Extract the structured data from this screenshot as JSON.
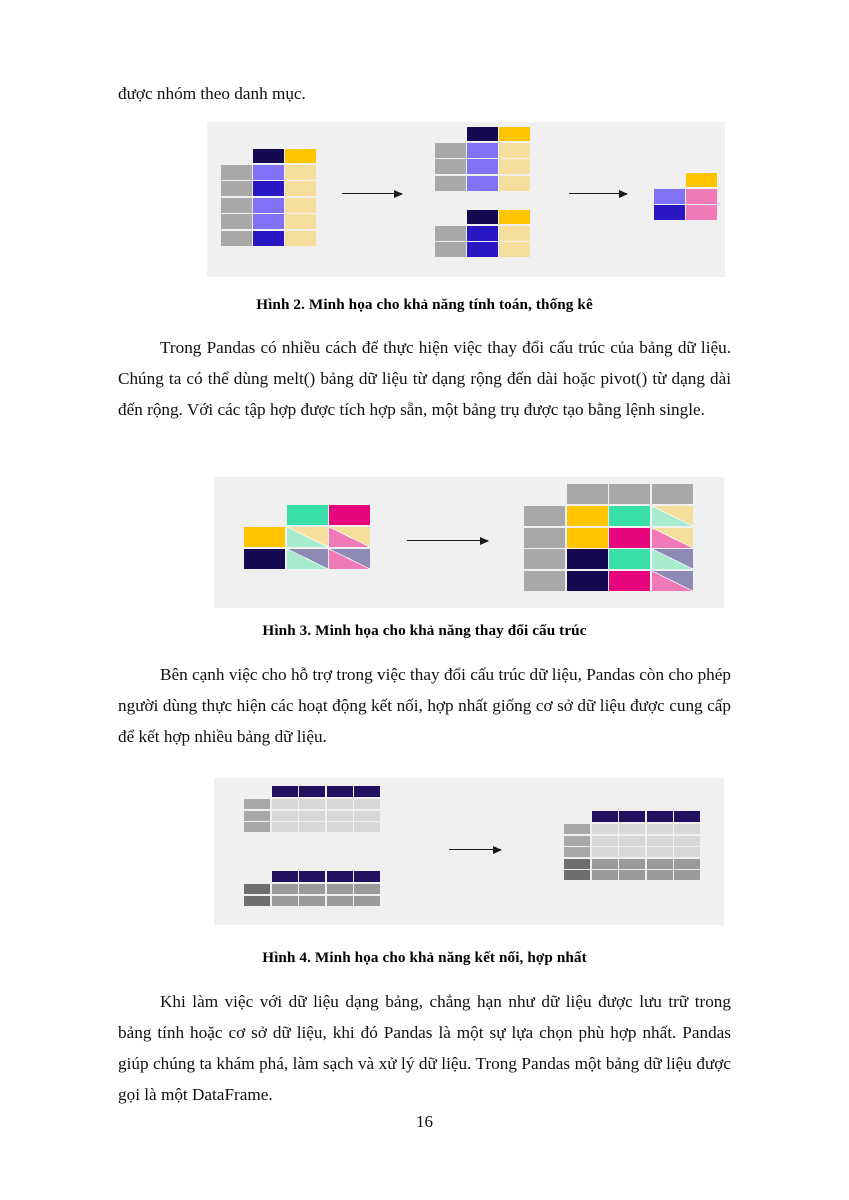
{
  "page": {
    "number": "16",
    "background": "#ffffff",
    "figure_panel_bg": "#f0f0f0"
  },
  "paragraphs": {
    "p0": "được nhóm theo danh mục.",
    "p1": "Trong Pandas có nhiều cách để thực hiện việc thay đổi cấu trúc của bảng dữ liệu. Chúng ta có thể dùng melt() bảng dữ liệu từ dạng rộng đến dài hoặc pivot() từ dạng dài đến rộng. Với các tập hợp được tích hợp sẵn, một bảng trụ được tạo bằng lệnh single.",
    "p2": "Bên cạnh việc cho hỗ trợ trong việc thay đổi cấu trúc dữ liệu, Pandas còn cho phép người dùng thực hiện các hoạt động kết nối, hợp nhất giống cơ sở dữ liệu được cung cấp để kết hợp nhiều bảng dữ liệu.",
    "p3": "Khi làm việc với dữ liệu dạng bảng, chẳng hạn như dữ liệu được lưu trữ trong bảng tính hoặc cơ sở dữ liệu, khi đó Pandas là một sự lựa chọn phù hợp nhất. Pandas giúp chúng ta khám phá, làm sạch và xử lý dữ liệu. Trong Pandas một bảng dữ liệu được gọi là một DataFrame."
  },
  "captions": {
    "fig2": "Hình 2. Minh họa cho khả năng tính toán, thống kê",
    "fig3": "Hình 3. Minh họa cho khả năng thay đổi cấu trúc",
    "fig4": "Hình 4. Minh họa cho khả năng kết nối, hợp nhất"
  },
  "palette": {
    "gray": "#a8a8a8",
    "gray_light": "#d7d7d7",
    "gray_mid": "#9a9a9a",
    "gray_dark": "#6e6e6e",
    "navy": "#150a4f",
    "navy_header": "#221060",
    "blue": "#2a17c4",
    "periwinkle": "#8172f5",
    "gold": "#ffc400",
    "cream": "#f5dd9b",
    "pink": "#f07ab8",
    "magenta": "#e8067f",
    "mint": "#38dfa6",
    "mint_light": "#a8ecd0",
    "slate": "#8d8bb5",
    "panel": "#f0f0f0"
  },
  "figure2": {
    "name": "groupby-aggregation-illustration",
    "arrows": 2,
    "source_table": {
      "header": [
        null,
        "navy",
        "gold"
      ],
      "rows": [
        [
          "gray",
          "periwinkle",
          "cream"
        ],
        [
          "gray",
          "blue",
          "cream"
        ],
        [
          "gray",
          "periwinkle",
          "cream"
        ],
        [
          "gray",
          "periwinkle",
          "cream"
        ],
        [
          "gray",
          "blue",
          "cream"
        ]
      ]
    },
    "group_top_table": {
      "header": [
        null,
        "navy",
        "gold"
      ],
      "rows": [
        [
          "gray",
          "periwinkle",
          "cream"
        ],
        [
          "gray",
          "periwinkle",
          "cream"
        ],
        [
          "gray",
          "periwinkle",
          "cream"
        ]
      ]
    },
    "group_bottom_table": {
      "header": [
        null,
        "navy",
        "gold"
      ],
      "rows": [
        [
          "gray",
          "blue",
          "cream"
        ],
        [
          "gray",
          "blue",
          "cream"
        ]
      ]
    },
    "result_table": {
      "header": [
        null,
        "gold"
      ],
      "rows": [
        [
          "periwinkle",
          "pink"
        ],
        [
          "blue",
          "pink"
        ]
      ]
    }
  },
  "figure3": {
    "name": "pivot-reshape-illustration",
    "arrows": 1,
    "source_table": {
      "header": [
        null,
        "mint",
        "magenta"
      ],
      "rows": [
        [
          "gold",
          {
            "upper": "cream",
            "lower": "mint_light"
          },
          {
            "upper": "cream",
            "lower": "pink"
          }
        ],
        [
          "navy",
          {
            "upper": "slate",
            "lower": "mint_light"
          },
          {
            "upper": "slate",
            "lower": "pink"
          }
        ]
      ]
    },
    "result_table": {
      "header": [
        null,
        "gray",
        "gray",
        "gray"
      ],
      "rows": [
        [
          "gray",
          "gold",
          "mint",
          {
            "upper": "cream",
            "lower": "mint_light"
          }
        ],
        [
          "gray",
          "gold",
          "magenta",
          {
            "upper": "cream",
            "lower": "pink"
          }
        ],
        [
          "gray",
          "navy",
          "mint",
          {
            "upper": "slate",
            "lower": "mint_light"
          }
        ],
        [
          "gray",
          "navy",
          "magenta",
          {
            "upper": "slate",
            "lower": "pink"
          }
        ]
      ]
    }
  },
  "figure4": {
    "name": "concat-merge-illustration",
    "arrows": 1,
    "top_table": {
      "header": [
        "navy",
        "navy",
        "navy",
        "navy"
      ],
      "index_color": "gray",
      "body_color": "gray_light",
      "rows": 3,
      "cols": 4
    },
    "bottom_table": {
      "header": [
        "navy",
        "navy",
        "navy",
        "navy"
      ],
      "index_color": "gray_dark",
      "body_color": "gray_mid",
      "rows": 2,
      "cols": 4
    },
    "result_table": {
      "header": [
        "navy",
        "navy",
        "navy",
        "navy"
      ],
      "top_index_color": "gray",
      "top_body_color": "gray_light",
      "top_rows": 3,
      "bottom_index_color": "gray_dark",
      "bottom_body_color": "gray_mid",
      "bottom_rows": 2,
      "cols": 4
    }
  }
}
